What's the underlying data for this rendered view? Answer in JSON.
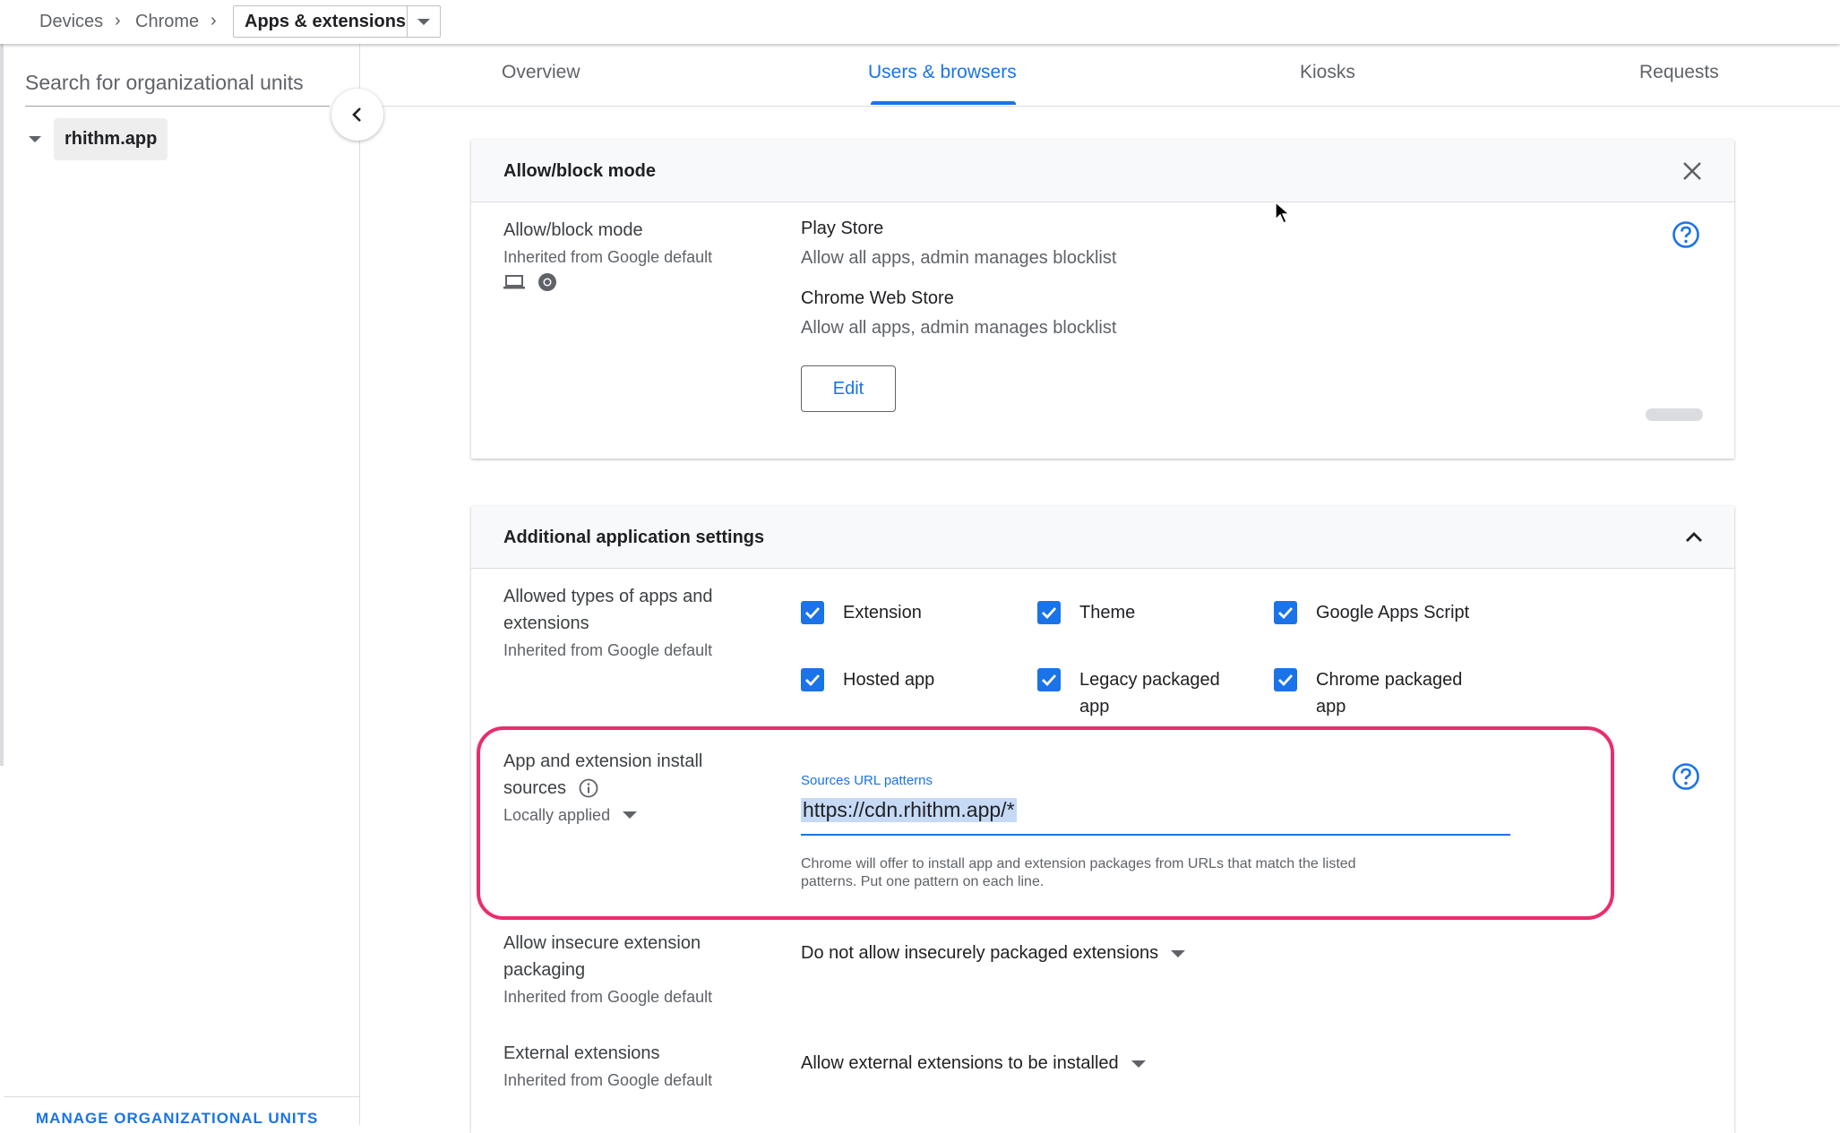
{
  "breadcrumb": {
    "items": [
      "Devices",
      "Chrome"
    ],
    "current": "Apps & extensions"
  },
  "sidebar": {
    "search_placeholder": "Search for organizational units",
    "org_unit": "rhithm.app",
    "manage_link": "MANAGE ORGANIZATIONAL UNITS"
  },
  "tabs": [
    {
      "label": "Overview",
      "active": false
    },
    {
      "label": "Users & browsers",
      "active": true
    },
    {
      "label": "Kiosks",
      "active": false
    },
    {
      "label": "Requests",
      "active": false
    }
  ],
  "allow_block_card": {
    "title": "Allow/block mode",
    "setting_name": "Allow/block mode",
    "setting_sub": "Inherited from Google default",
    "play_store_title": "Play Store",
    "play_store_value": "Allow all apps, admin manages blocklist",
    "web_store_title": "Chrome Web Store",
    "web_store_value": "Allow all apps, admin manages blocklist",
    "edit_label": "Edit"
  },
  "additional_card": {
    "title": "Additional application settings",
    "allowed_types": {
      "name_line1": "Allowed types of apps and",
      "name_line2": "extensions",
      "sub": "Inherited from Google default",
      "options": [
        {
          "label": "Extension",
          "checked": true
        },
        {
          "label": "Theme",
          "checked": true
        },
        {
          "label": "Google Apps Script",
          "checked": true
        },
        {
          "label": "Hosted app",
          "checked": true
        },
        {
          "label_line1": "Legacy packaged",
          "label_line2": "app",
          "checked": true
        },
        {
          "label_line1": "Chrome packaged",
          "label_line2": "app",
          "checked": true
        }
      ]
    },
    "install_sources": {
      "name_line1": "App and extension install",
      "name_line2": "sources",
      "sub": "Locally applied",
      "field_label": "Sources URL patterns",
      "field_value": "https://cdn.rhithm.app/*",
      "help_line1": "Chrome will offer to install app and extension packages from URLs that match the listed",
      "help_line2": "patterns. Put one pattern on each line."
    },
    "insecure_packaging": {
      "name_line1": "Allow insecure extension",
      "name_line2": "packaging",
      "sub": "Inherited from Google default",
      "value": "Do not allow insecurely packaged extensions"
    },
    "external_extensions": {
      "name": "External extensions",
      "sub": "Inherited from Google default",
      "value": "Allow external extensions to be installed"
    }
  },
  "colors": {
    "accent": "#1a73e8",
    "highlight": "#ea2d6b"
  }
}
